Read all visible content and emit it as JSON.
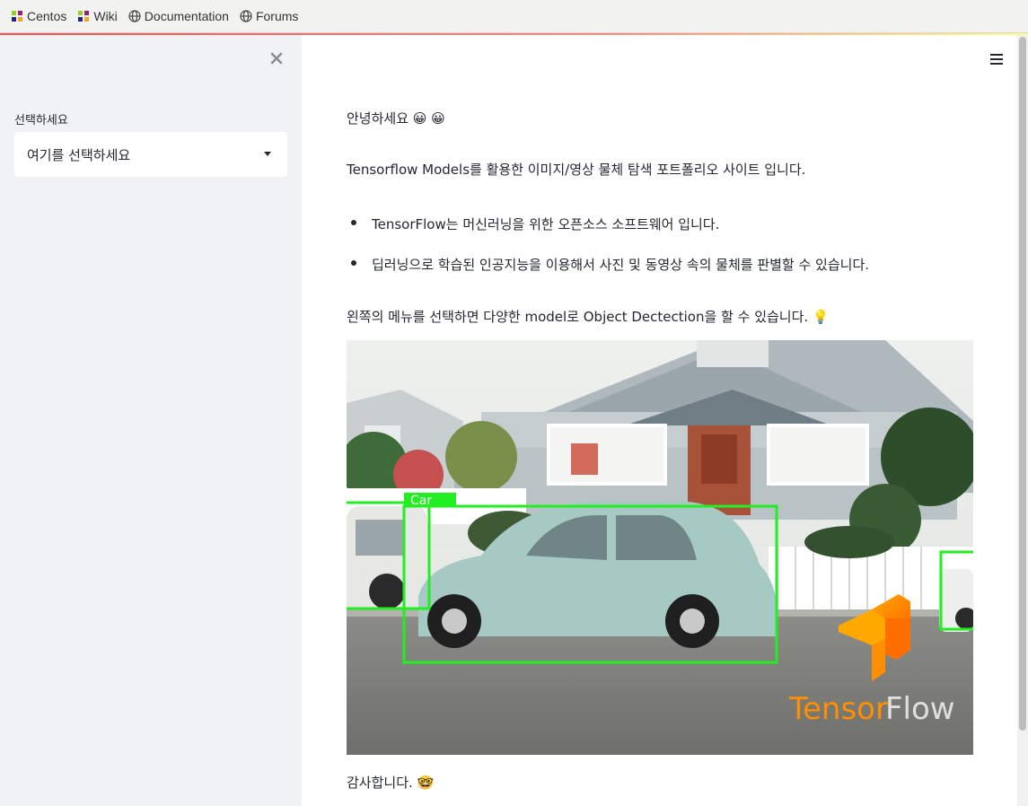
{
  "bookmarks": [
    {
      "label": "Centos",
      "icon": "centos-icon"
    },
    {
      "label": "Wiki",
      "icon": "centos-icon"
    },
    {
      "label": "Documentation",
      "icon": "globe-icon"
    },
    {
      "label": "Forums",
      "icon": "globe-icon"
    }
  ],
  "sidebar": {
    "select_label": "선택하세요",
    "select_value": "여기를 선택하세요"
  },
  "main": {
    "greeting": "안녕하세요 😀 😀",
    "intro": "Tensorflow Models를 활용한 이미지/영상 물체 탐색 포트폴리오 사이트 입니다.",
    "bullets": [
      "TensorFlow는 머신러닝을 위한 오픈소스 소프트웨어 입니다.",
      "딥러닝으로 학습된 인공지능을 이용해서 사진 및 동영상 속의 물체를 판별할 수 있습니다."
    ],
    "guide": "왼쪽의 메뉴를 선택하면 다양한 model로 Object Dectection을 할 수 있습니다. 💡",
    "image": {
      "detection_label": "Car",
      "brand_text": "TensorFlow"
    },
    "thanks": "감사합니다. 🤓"
  },
  "colors": {
    "accent": "#ff4b4b",
    "sidebar_bg": "#f0f2f6",
    "detection_box": "#22ee22",
    "tf_orange": "#ff8f00"
  }
}
